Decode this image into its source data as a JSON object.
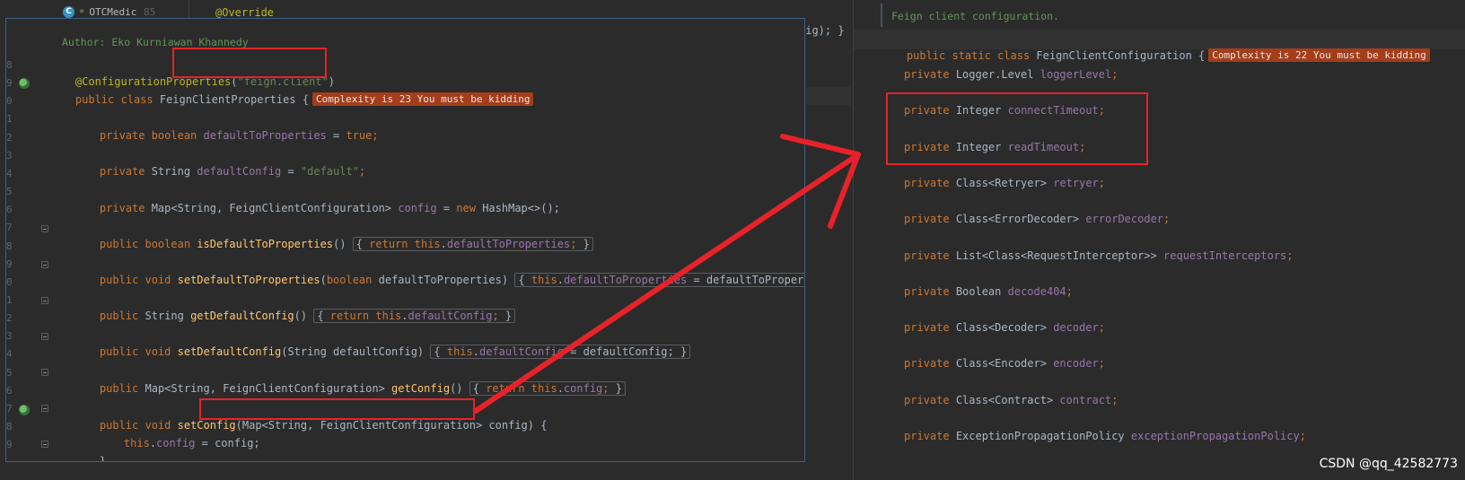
{
  "background_editor": {
    "tab_label": "OTCMedic",
    "tab_icon_letter": "C",
    "line_number": "85",
    "override_annotation": "@Override",
    "config_tail": "fig); }"
  },
  "left_popup": {
    "author_comment": "Author: Eko Kurniawan Khannedy",
    "line_numbers": [
      "8",
      "9",
      "0",
      "1",
      "2",
      "3",
      "4",
      "5",
      "6",
      "7",
      "8",
      "9",
      "0",
      "1",
      "2",
      "3",
      "4",
      "5",
      "6",
      "7",
      "8",
      "9"
    ],
    "annotation": "@ConfigurationProperties",
    "annotation_open": "(",
    "annotation_value": "\"feign.client\"",
    "annotation_close": ")",
    "class_kw1": "public",
    "class_kw2": "class",
    "class_name": "FeignClientProperties",
    "class_brace": "{",
    "complexity_badge": "Complexity is 23 You must be kidding",
    "lines": {
      "f1_kw": "private boolean",
      "f1_name": "defaultToProperties",
      "f1_eq": " = ",
      "f1_val": "true",
      "f1_semi": ";",
      "f2_kw": "private",
      "f2_type": " String ",
      "f2_name": "defaultConfig",
      "f2_eq": " = ",
      "f2_val": "\"default\"",
      "f2_semi": ";",
      "f3_kw": "private",
      "f3_type": " Map<String, FeignClientConfiguration> ",
      "f3_name": "config",
      "f3_eq": " = ",
      "f3_new": "new",
      "f3_rest": " HashMap<>();",
      "m1_kw": "public boolean",
      "m1_name": "isDefaultToProperties",
      "m1_parens": "()",
      "m1_body_kw": "return",
      "m1_body_this": " this",
      "m1_body_dot": ".",
      "m1_body_fld": "defaultToProperties",
      "m1_body_semi": ";",
      "m1_close": "}",
      "m2_kw": "public void",
      "m2_name": "setDefaultToProperties",
      "m2_params_open": "(",
      "m2_param_kw": "boolean",
      "m2_param_name": " defaultToProperties",
      "m2_params_close": ")",
      "m2_body_this": "this",
      "m2_body_dot": ".",
      "m2_body_fld": "defaultToProperties",
      "m2_body_rest": " = defaultToProperties;",
      "m2_close": "}",
      "m3_kw": "public",
      "m3_type": " String ",
      "m3_name": "getDefaultConfig",
      "m3_parens": "()",
      "m3_body_kw": "return",
      "m3_body_this": " this",
      "m3_body_dot": ".",
      "m3_body_fld": "defaultConfig",
      "m3_body_semi": ";",
      "m3_close": "}",
      "m4_kw": "public void",
      "m4_name": "setDefaultConfig",
      "m4_params": "(String defaultConfig)",
      "m4_body_this": "this",
      "m4_body_dot": ".",
      "m4_body_fld": "defaultConfig",
      "m4_body_rest": " = defaultConfig;",
      "m4_close": "}",
      "m5_kw": "public",
      "m5_type": " Map<String, FeignClientConfiguration> ",
      "m5_name": "getConfig",
      "m5_parens": "()",
      "m5_body_kw": "return",
      "m5_body_this": " this",
      "m5_body_dot": ".",
      "m5_body_fld": "config",
      "m5_body_semi": ";",
      "m5_close": "}",
      "m6_kw": "public void",
      "m6_name": "setConfig",
      "m6_params": "(Map<String, FeignClientConfiguration> config)",
      "m6_brace": " {",
      "m6_body_this": "this",
      "m6_body_dot": ".",
      "m6_body_fld": "config",
      "m6_body_rest": " = config;",
      "close_brace": "}"
    }
  },
  "right_panel": {
    "doc_comment": "Feign client configuration.",
    "class_kw": "public static class",
    "class_name": "FeignClientConfiguration",
    "class_brace": "{",
    "complexity_badge": "Complexity is 22 You must be kidding",
    "fields": [
      {
        "kw": "private",
        "type": "Logger.Level",
        "name": "loggerLevel"
      },
      {
        "kw": "private",
        "type": "Integer",
        "name": "connectTimeout"
      },
      {
        "kw": "private",
        "type": "Integer",
        "name": "readTimeout"
      },
      {
        "kw": "private",
        "type": "Class<Retryer>",
        "name": "retryer"
      },
      {
        "kw": "private",
        "type": "Class<ErrorDecoder>",
        "name": "errorDecoder"
      },
      {
        "kw": "private",
        "type": "List<Class<RequestInterceptor>>",
        "name": "requestInterceptors"
      },
      {
        "kw": "private",
        "type": "Boolean",
        "name": "decode404"
      },
      {
        "kw": "private",
        "type": "Class<Decoder>",
        "name": "decoder"
      },
      {
        "kw": "private",
        "type": "Class<Encoder>",
        "name": "encoder"
      },
      {
        "kw": "private",
        "type": "Class<Contract>",
        "name": "contract"
      },
      {
        "kw": "private",
        "type": "ExceptionPropagationPolicy",
        "name": "exceptionPropagationPolicy"
      }
    ]
  },
  "watermark": "CSDN @qq_42582773",
  "colors": {
    "annotation_red": "#e8222a",
    "keyword": "#cc7832",
    "method": "#ffc66d",
    "field": "#9876aa",
    "string": "#6a8759",
    "badge": "#a33d1a"
  }
}
